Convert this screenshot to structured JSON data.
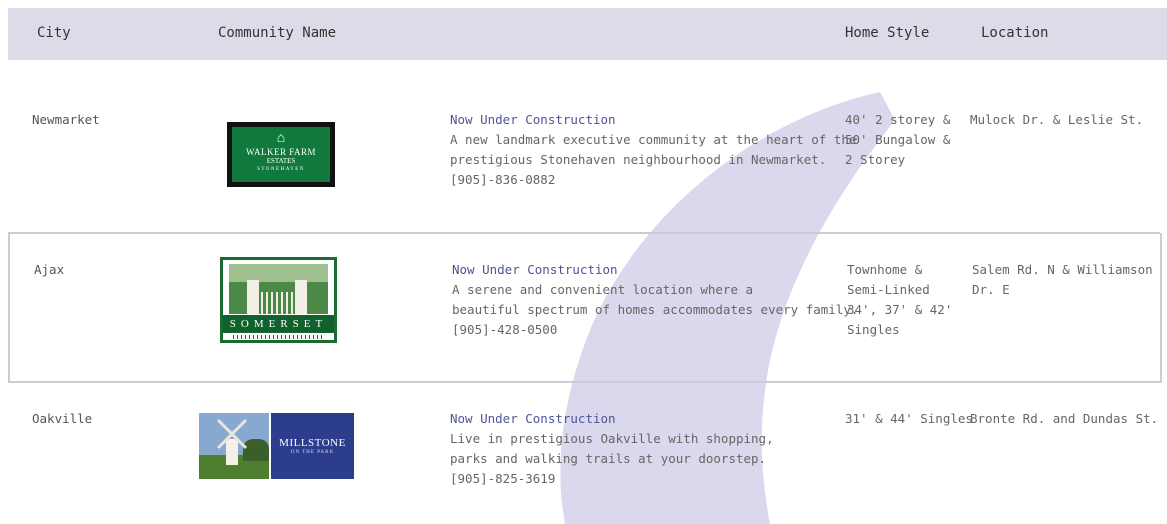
{
  "header": {
    "city": "City",
    "community": "Community Name",
    "style": "Home Style",
    "location": "Location"
  },
  "rows": [
    {
      "city": "Newmarket",
      "logo": {
        "icon": "walker-farm-estates-logo",
        "line1": "WALKER FARM",
        "line2": "ESTATES",
        "line3": "STONEHAVEN"
      },
      "status": "Now Under Construction",
      "desc": [
        "A new landmark executive community at the heart of the",
        "prestigious Stonehaven neighbourhood in Newmarket."
      ],
      "phone": "[905]-836-0882",
      "style": [
        "40' 2 storey &",
        "50' Bungalow &",
        "2 Storey"
      ],
      "location": "Mulock Dr. & Leslie St."
    },
    {
      "city": "Ajax",
      "logo": {
        "icon": "somerset-logo",
        "name": "SOMERSET"
      },
      "status": "Now Under Construction",
      "desc": [
        "A serene and convenient location where a",
        "beautiful spectrum of homes accommodates every family."
      ],
      "phone": "[905]-428-0500",
      "style": [
        "Townhome &",
        "Semi-Linked",
        "34', 37' & 42'",
        "Singles"
      ],
      "location": "Salem Rd. N & Williamson Dr. E"
    },
    {
      "city": "Oakville",
      "logo": {
        "icon": "millstone-on-the-park-logo",
        "name": "MILLSTONE",
        "sub": "ON THE PARK"
      },
      "status": "Now Under Construction",
      "desc": [
        "Live in prestigious Oakville with shopping,",
        "parks and walking trails at your doorstep."
      ],
      "phone": "[905]-825-3619",
      "style": [
        "31' & 44' Singles"
      ],
      "location": "Bronte Rd. and Dundas St."
    }
  ],
  "colors": {
    "header_bg": "#dcdbe8",
    "accent": "#4f5496",
    "watermark": "#d9d8ec"
  }
}
